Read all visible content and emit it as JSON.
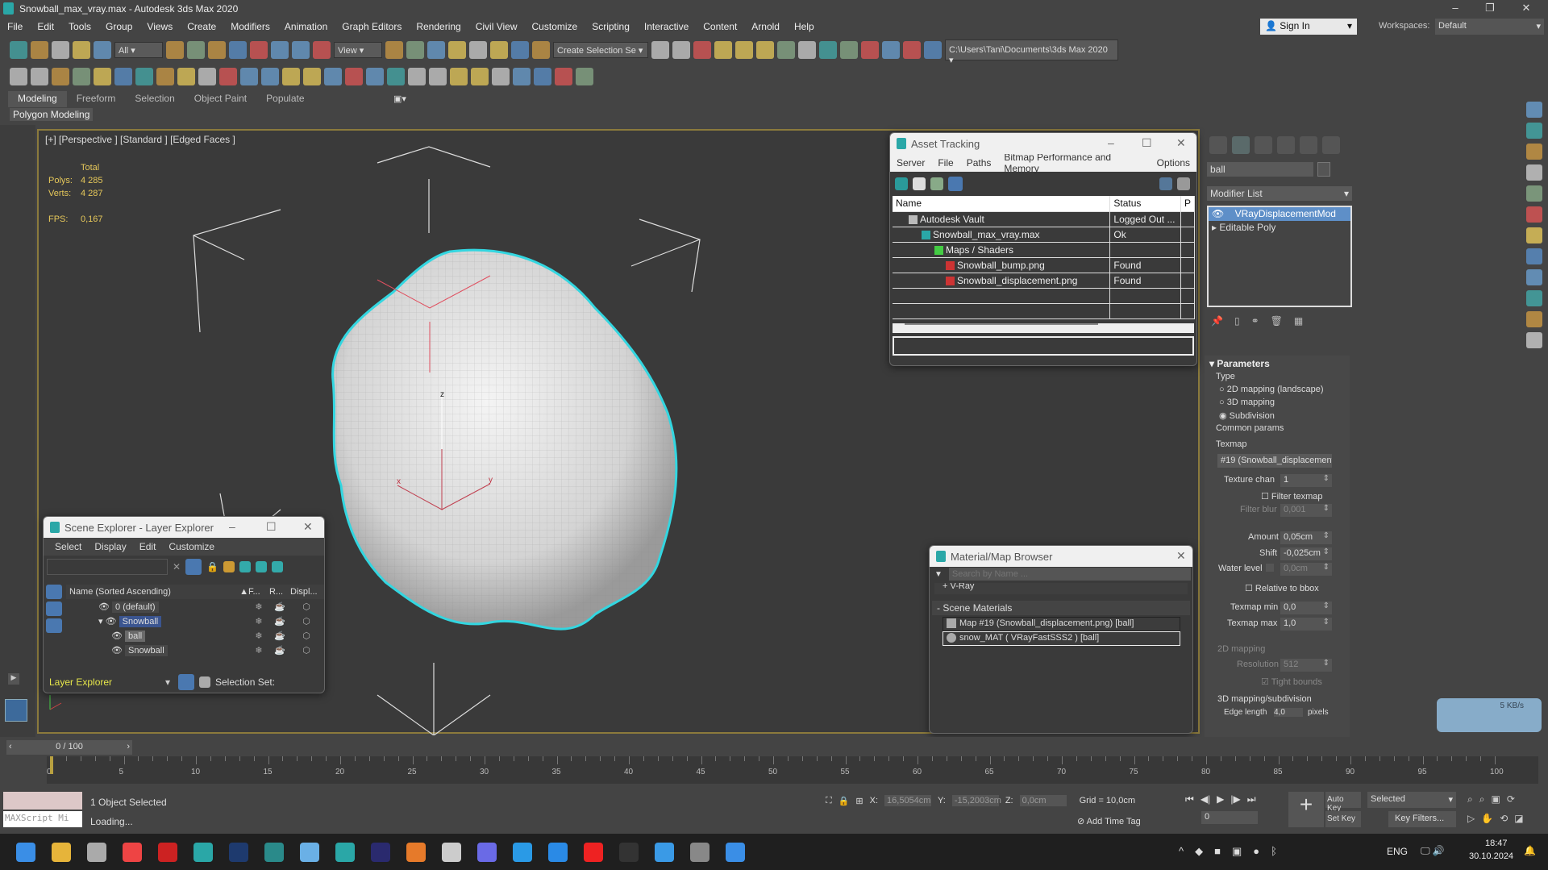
{
  "window": {
    "title": "Snowball_max_vray.max - Autodesk 3ds Max 2020",
    "min": "–",
    "max": "❐",
    "close": "✕"
  },
  "menu": [
    "File",
    "Edit",
    "Tools",
    "Group",
    "Views",
    "Create",
    "Modifiers",
    "Animation",
    "Graph Editors",
    "Rendering",
    "Civil View",
    "Customize",
    "Scripting",
    "Interactive",
    "Content",
    "Arnold",
    "Help"
  ],
  "account": {
    "sign_in": "Sign In",
    "workspaces_label": "Workspaces:",
    "workspace": "Default"
  },
  "toolbar": {
    "filter": "All",
    "ref_coord": "View",
    "selection_set": "Create Selection Se",
    "project_path": "C:\\Users\\Tani\\Documents\\3ds Max 2020"
  },
  "toolbar1_icons": [
    "undo-icon",
    "redo-icon",
    "link-icon",
    "unlink-icon",
    "bind-space-warp-icon"
  ],
  "toolbar1b_icons": [
    "select-object-icon",
    "select-by-name-icon",
    "rect-region-icon",
    "window-crossing-icon",
    "move-icon",
    "rotate-icon",
    "scale-icon",
    "placement-icon"
  ],
  "toolbar1c_icons": [
    "pivot-icon",
    "selection-lock-icon",
    "select-manipulate-icon",
    "snap-3-icon",
    "angle-snap-icon",
    "percent-snap-icon",
    "spinner-snap-icon",
    "edit-named-sel-icon"
  ],
  "toolbar1d_icons": [
    "mirror-icon",
    "align-icon",
    "scene-explorer-icon",
    "layer-explorer-icon",
    "ribbon-toggle-icon",
    "curve-editor-icon",
    "schematic-icon",
    "material-editor-icon",
    "render-setup-icon",
    "rendered-frame-icon",
    "render-icon",
    "render-iterative-icon",
    "render-cloud-icon",
    "render-layout-icon"
  ],
  "toolbar2_icons": [
    "teapot-icon",
    "plane-icon",
    "box-icon",
    "grid-icon",
    "grid2-icon",
    "light-icon",
    "camera-icon",
    "helper-icon",
    "spacewarp-icon",
    "shape-icon",
    "sphere-icon",
    "cylinder-icon",
    "teapot2-icon",
    "cone-icon",
    "sun-icon",
    "ball-icon",
    "vray-fur-icon",
    "vray-proxy-icon",
    "vray-plane-icon",
    "vray-sphere-icon",
    "vray-grass-icon",
    "hdri-icon",
    "sss-icon",
    "material-sphere-icon",
    "vfb-icon",
    "vray-logo-icon",
    "lister-icon",
    "help-icon"
  ],
  "ribbon": {
    "tabs": [
      "Modeling",
      "Freeform",
      "Selection",
      "Object Paint",
      "Populate"
    ],
    "panel": "Polygon Modeling"
  },
  "viewport": {
    "label": "[+] [Perspective ] [Standard ] [Edged Faces ]",
    "stats_header": "Total",
    "polys_label": "Polys:",
    "polys": "4 285",
    "verts_label": "Verts:",
    "verts": "4 287",
    "fps_label": "FPS:",
    "fps": "0,167",
    "axis_x": "x",
    "axis_y": "y",
    "axis_z": "z",
    "accent": "#33d6e0"
  },
  "asset_tracking": {
    "title": "Asset Tracking",
    "menu": [
      "Server",
      "File",
      "Paths",
      "Bitmap Performance and Memory",
      "Options"
    ],
    "columns": [
      "Name",
      "Status",
      "P"
    ],
    "rows": [
      {
        "name": "Autodesk Vault",
        "status": "Logged Out ..."
      },
      {
        "name": "Snowball_max_vray.max",
        "status": "Ok"
      },
      {
        "name": "Maps / Shaders",
        "status": ""
      },
      {
        "name": "Snowball_bump.png",
        "status": "Found"
      },
      {
        "name": "Snowball_displacement.png",
        "status": "Found"
      }
    ]
  },
  "command_panel": {
    "object_name": "ball",
    "modifier_list": "Modifier List",
    "stack": [
      "VRayDisplacementMod",
      "Editable Poly"
    ],
    "rollout": "Parameters",
    "type_label": "Type",
    "types": [
      "2D mapping (landscape)",
      "3D mapping",
      "Subdivision"
    ],
    "selected_type": 2,
    "common_params": "Common params",
    "texmap_label": "Texmap",
    "texmap": "#19 (Snowball_displacement.",
    "texture_chan_label": "Texture chan",
    "texture_chan": "1",
    "filter_texmap": "Filter texmap",
    "filter_blur_label": "Filter blur",
    "filter_blur": "0,001",
    "amount_label": "Amount",
    "amount": "0,05cm",
    "shift_label": "Shift",
    "shift": "-0,025cm",
    "water_level_label": "Water level",
    "water_level": "0,0cm",
    "relative_bbox": "Relative to bbox",
    "texmap_min_label": "Texmap min",
    "texmap_min": "0,0",
    "texmap_max_label": "Texmap max",
    "texmap_max": "1,0",
    "mapping2d": "2D mapping",
    "resolution_label": "Resolution",
    "resolution": "512",
    "tight_bounds": "Tight bounds",
    "mapping3d": "3D mapping/subdivision",
    "edge_length_label": "Edge length",
    "edge_length": "4,0",
    "pixels": "pixels"
  },
  "scene_explorer": {
    "title": "Scene Explorer - Layer Explorer",
    "menu": [
      "Select",
      "Display",
      "Edit",
      "Customize"
    ],
    "columns": [
      "Name (Sorted Ascending)",
      "F...",
      "R...",
      "Displ..."
    ],
    "rows": [
      "0 (default)",
      "Snowball",
      "ball",
      "Snowball"
    ],
    "mode": "Layer Explorer",
    "selection_set": "Selection Set:"
  },
  "material_browser": {
    "title": "Material/Map Browser",
    "search_placeholder": "Search by Name ...",
    "vray": "+ V-Ray",
    "scene_materials": "- Scene Materials",
    "items": [
      "Map #19 (Snowball_displacement.png) [ball]",
      "snow_MAT ( VRayFastSSS2 ) [ball]"
    ]
  },
  "network": {
    "speed": "5 KB/s"
  },
  "timeline": {
    "frame": "0 / 100",
    "start": 0,
    "end": 100,
    "step": 5
  },
  "status": {
    "maxscript": "MAXScript Mi",
    "selected": "1 Object Selected",
    "loading": "Loading...",
    "x_label": "X:",
    "x": "16,5054cm",
    "y_label": "Y:",
    "y": "-15,2003cm",
    "z_label": "Z:",
    "z": "0,0cm",
    "grid": "Grid = 10,0cm",
    "add_time_tag": "Add Time Tag",
    "auto_key": "Auto Key",
    "set_key": "Set Key",
    "key_mode": "Selected",
    "key_filters": "Key Filters...",
    "frame_field": "0"
  },
  "taskbar": {
    "lang": "ENG",
    "time": "18:47",
    "date": "30.10.2024",
    "apps": [
      "start-icon",
      "explorer-icon",
      "app-icon",
      "chrome-icon",
      "app64-icon",
      "3dsmax-icon",
      "photoshop-icon",
      "app-icon",
      "notepad-icon",
      "3dsmax-active-icon",
      "after-effects-icon",
      "app-g-icon",
      "app-icon",
      "save-icon",
      "edge-icon",
      "app-icon",
      "yandex-icon",
      "terminal-icon",
      "telegram-icon",
      "calculator-icon",
      "app-icon"
    ]
  }
}
